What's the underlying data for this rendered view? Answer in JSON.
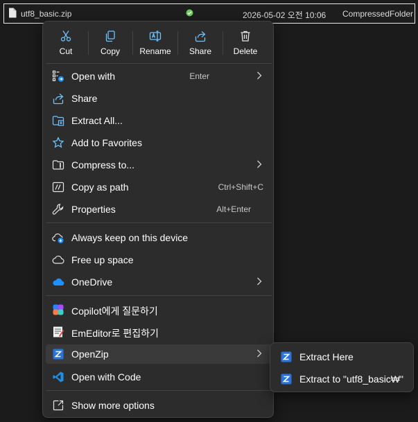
{
  "file": {
    "name": "utf8_basic.zip",
    "date": "2026-05-02 오전 10:06",
    "type": "CompressedFolder"
  },
  "toolbar": {
    "cut": "Cut",
    "copy": "Copy",
    "rename": "Rename",
    "share": "Share",
    "delete": "Delete"
  },
  "menu": {
    "open_with": {
      "label": "Open with",
      "shortcut": "Enter"
    },
    "share": {
      "label": "Share"
    },
    "extract_all": {
      "label": "Extract All..."
    },
    "add_favorites": {
      "label": "Add to Favorites"
    },
    "compress_to": {
      "label": "Compress to..."
    },
    "copy_path": {
      "label": "Copy as path",
      "shortcut": "Ctrl+Shift+C"
    },
    "properties": {
      "label": "Properties",
      "shortcut": "Alt+Enter"
    },
    "keep_on_device": {
      "label": "Always keep on this device"
    },
    "free_space": {
      "label": "Free up space"
    },
    "onedrive": {
      "label": "OneDrive"
    },
    "copilot": {
      "label": "Copilot에게 질문하기"
    },
    "emeditor": {
      "label": "EmEditor로 편집하기"
    },
    "openzip": {
      "label": "OpenZip"
    },
    "open_code": {
      "label": "Open with Code"
    },
    "more_options": {
      "label": "Show more options"
    }
  },
  "submenu": {
    "extract_here": "Extract Here",
    "extract_to": "Extract to \"utf8_basic₩\""
  },
  "colors": {
    "accent_blue": "#4cc2ff",
    "onedrive_blue": "#1e8fff",
    "openzip_blue": "#2b73d8",
    "sync_green": "#6ccb5f",
    "menu_bg": "#2c2c2c"
  },
  "icons": {
    "cut": "scissors-icon",
    "copy": "copy-icon",
    "rename": "rename-icon",
    "share": "share-icon",
    "delete": "trash-icon",
    "open_with": "open-with-icon",
    "extract_all": "folder-zip-icon",
    "add_favorites": "star-icon",
    "compress_to": "folder-icon",
    "copy_path": "path-icon",
    "properties": "wrench-icon",
    "keep_on_device": "cloud-download-icon",
    "free_space": "cloud-icon",
    "onedrive": "onedrive-icon",
    "copilot": "copilot-icon",
    "emeditor": "emeditor-icon",
    "openzip": "openzip-icon",
    "open_code": "vscode-icon",
    "more_options": "more-options-icon"
  }
}
